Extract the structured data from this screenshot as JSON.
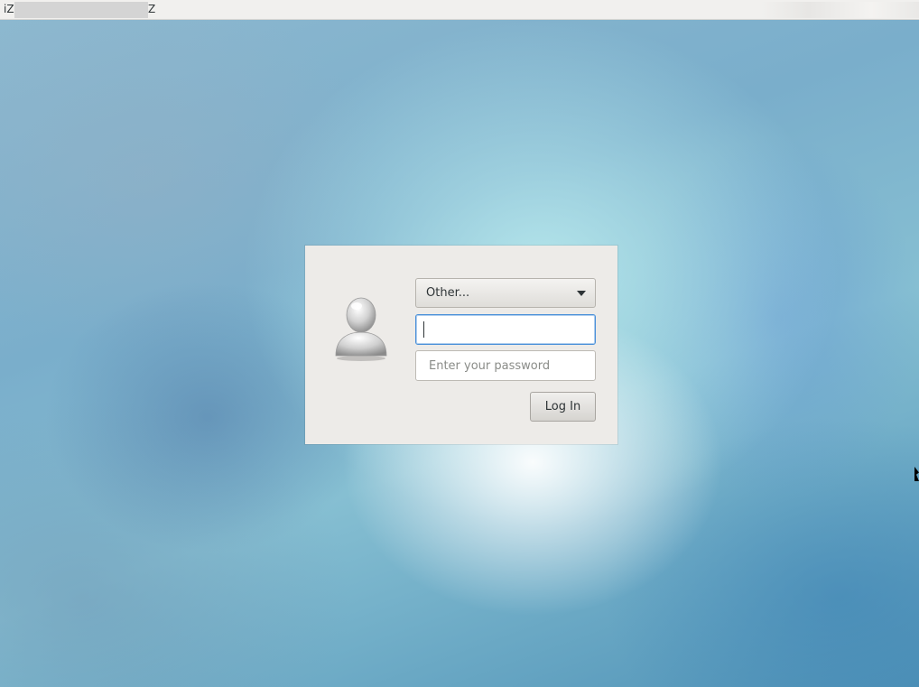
{
  "topbar": {
    "hostname_prefix": "iZ",
    "hostname_suffix": "Z"
  },
  "login": {
    "user_select": {
      "selected": "Other..."
    },
    "username_field": {
      "value": ""
    },
    "password_field": {
      "placeholder": "Enter your password"
    },
    "login_button": {
      "label": "Log In"
    }
  },
  "icons": {
    "avatar": "user-avatar-icon",
    "dropdown": "chevron-down-icon"
  },
  "colors": {
    "focus_accent": "#4a90d9",
    "dialog_background": "#edebe8"
  }
}
